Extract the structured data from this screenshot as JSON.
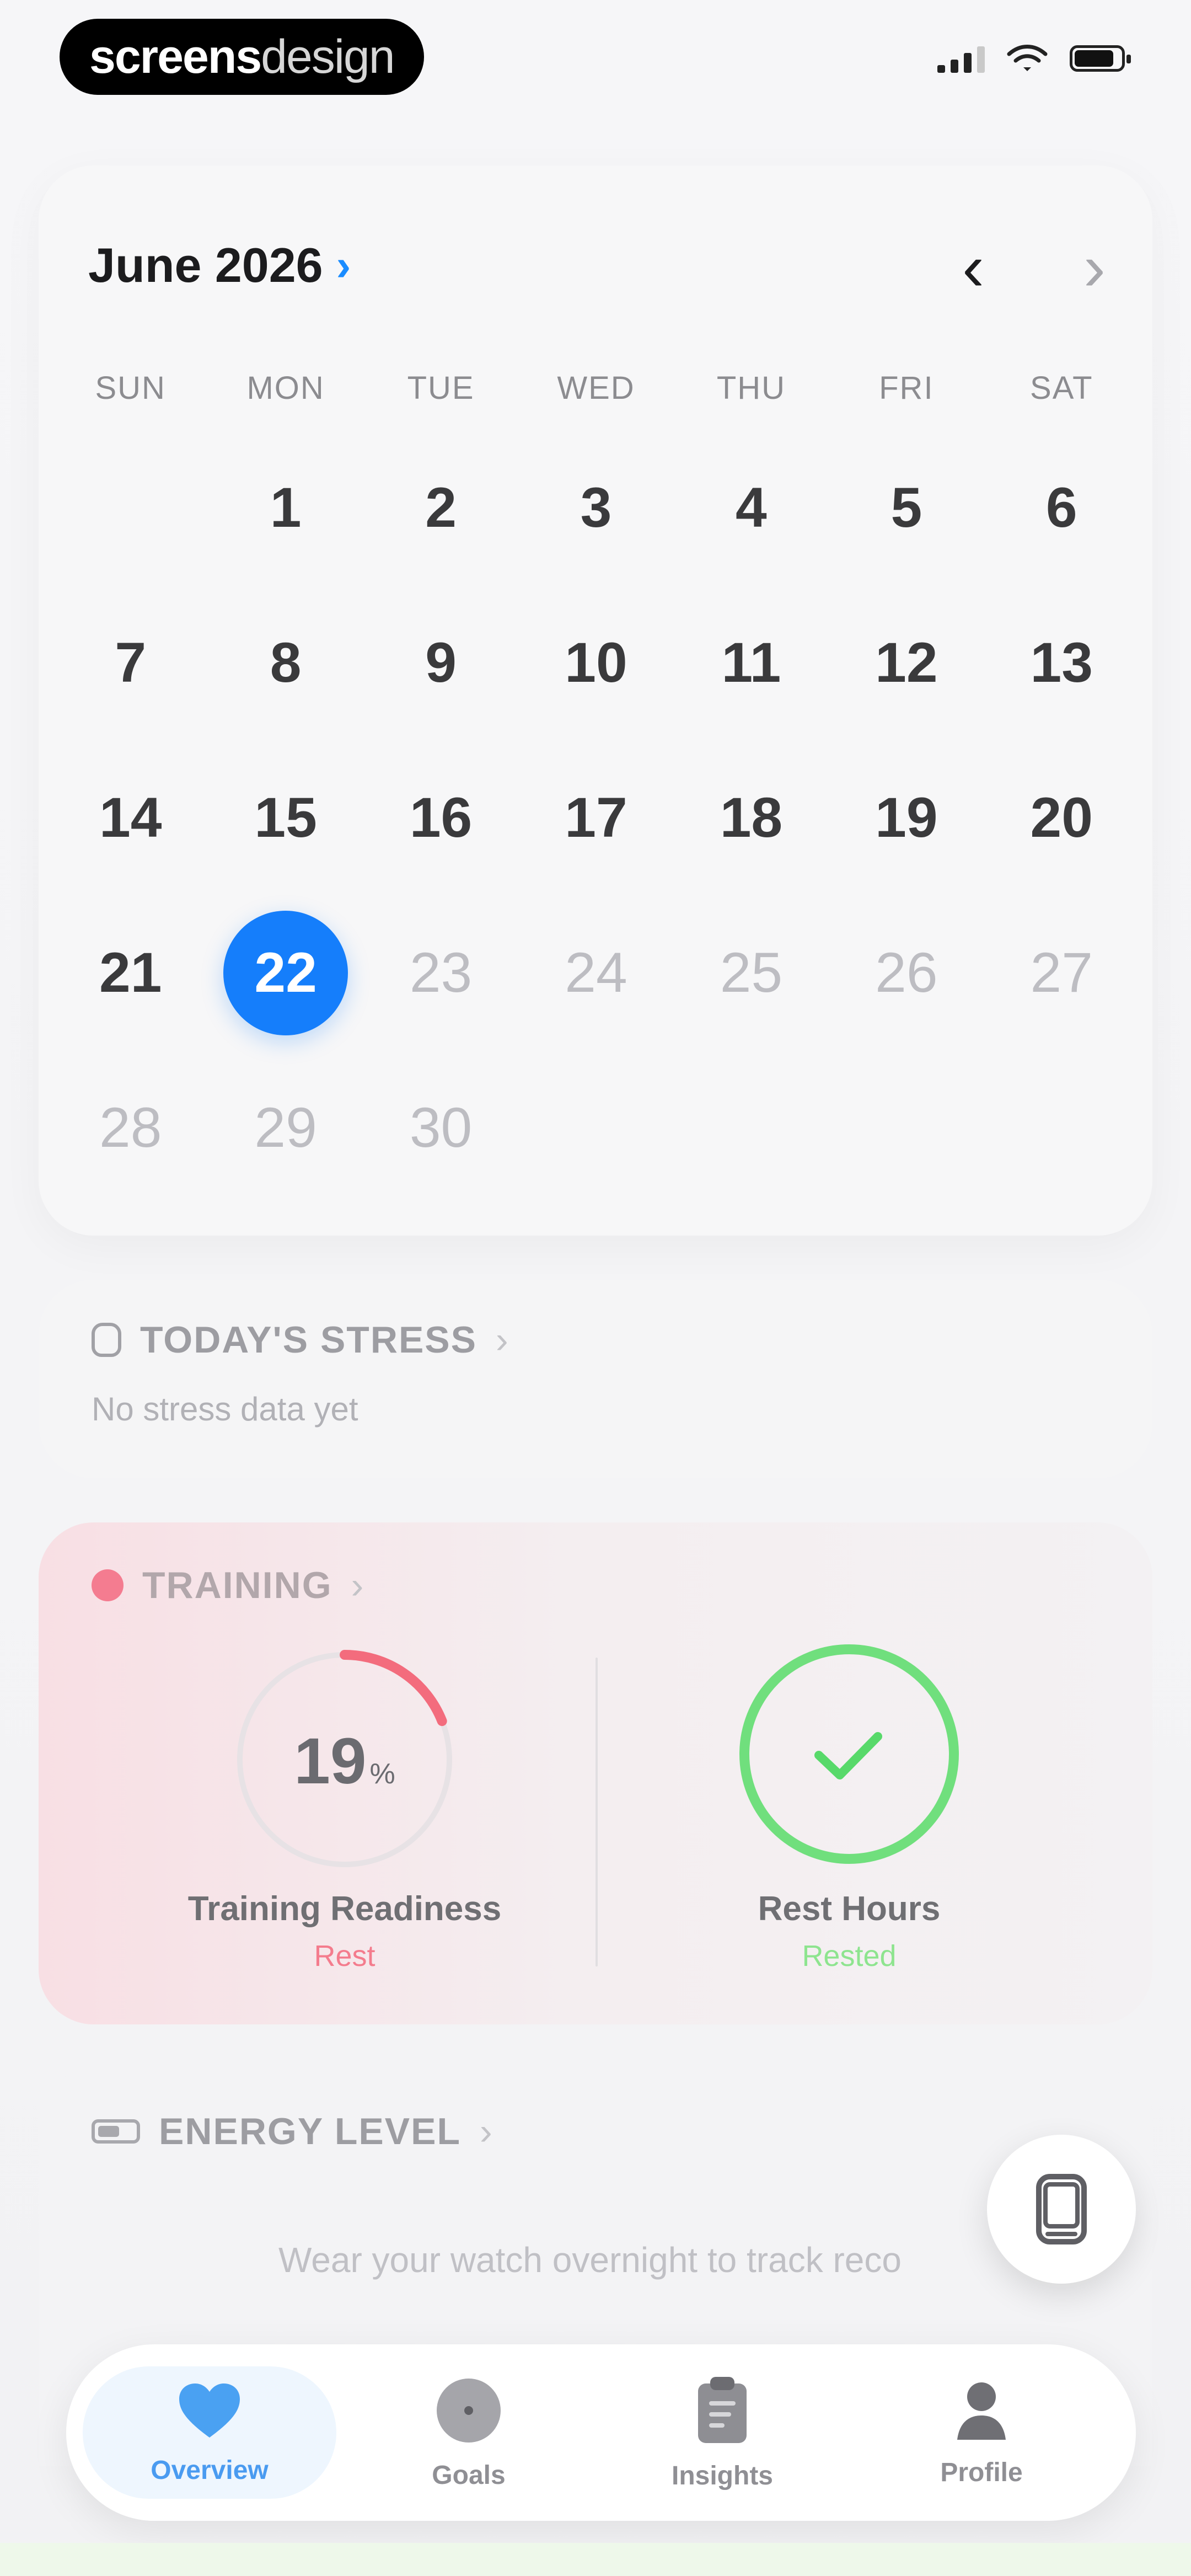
{
  "status_bar": {
    "brand_bold": "screens",
    "brand_light": "design"
  },
  "calendar": {
    "month_label": "June 2026",
    "weekdays": [
      "SUN",
      "MON",
      "TUE",
      "WED",
      "THU",
      "FRI",
      "SAT"
    ],
    "weeks": [
      [
        "",
        "1",
        "2",
        "3",
        "4",
        "5",
        "6"
      ],
      [
        "7",
        "8",
        "9",
        "10",
        "11",
        "12",
        "13"
      ],
      [
        "14",
        "15",
        "16",
        "17",
        "18",
        "19",
        "20"
      ],
      [
        "21",
        "22",
        "23",
        "24",
        "25",
        "26",
        "27"
      ],
      [
        "28",
        "29",
        "30",
        "",
        "",
        "",
        ""
      ]
    ],
    "selected_day": "22"
  },
  "stress": {
    "title": "TODAY'S STRESS",
    "message": "No stress data yet"
  },
  "training": {
    "title": "TRAINING",
    "readiness_value": "19",
    "readiness_unit": "%",
    "readiness_fraction": 0.19,
    "readiness_label": "Training Readiness",
    "readiness_status": "Rest",
    "rest_label": "Rest Hours",
    "rest_status": "Rested",
    "accent_red": "#f36c7d",
    "accent_green": "#70df7d"
  },
  "energy": {
    "title": "ENERGY LEVEL",
    "message": "Wear your watch overnight to track reco"
  },
  "tabs": [
    {
      "label": "Overview",
      "icon": "heart-icon",
      "active": true
    },
    {
      "label": "Goals",
      "icon": "target-icon",
      "active": false
    },
    {
      "label": "Insights",
      "icon": "clipboard-icon",
      "active": false
    },
    {
      "label": "Profile",
      "icon": "person-icon",
      "active": false
    }
  ],
  "colors": {
    "selected_blue": "#157efb",
    "chevron_blue": "#1a8cff",
    "active_tab_bg": "#eef6fe"
  }
}
